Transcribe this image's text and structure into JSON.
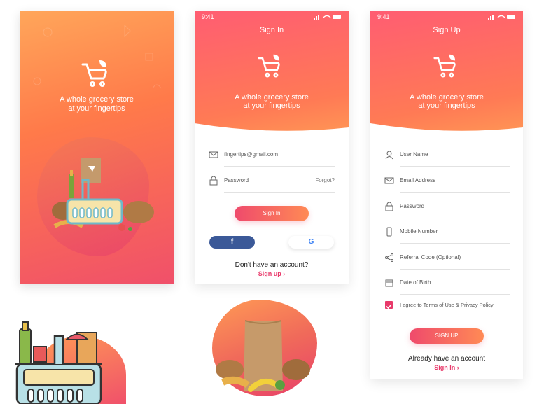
{
  "splash": {
    "tagline_line1": "A whole grocery store",
    "tagline_line2": "at your fingertips"
  },
  "signin": {
    "status_time": "9:41",
    "title": "Sign In",
    "tagline_line1": "A whole grocery store",
    "tagline_line2": "at your fingertips",
    "email_value": "fingertips@gmail.com",
    "password_placeholder": "Password",
    "forgot_label": "Forgot?",
    "signin_button": "Sign In",
    "facebook_glyph": "f",
    "google_glyph": "G",
    "no_account_text": "Don't have an account?",
    "signup_link": "Sign up"
  },
  "signup": {
    "status_time": "9:41",
    "title": "Sign Up",
    "tagline_line1": "A whole grocery store",
    "tagline_line2": "at your fingertips",
    "fields": {
      "username": "User Name",
      "email": "Email Address",
      "password": "Password",
      "mobile": "Mobile Number",
      "referral": "Referral Code (Optional)",
      "dob": "Date of Birth"
    },
    "agree_text": "I agree to Terms of Use & Privacy Policy",
    "agree_checked": true,
    "signup_button": "SIGN UP",
    "have_account_text": "Already have an account",
    "signin_link": "Sign In"
  },
  "colors": {
    "accent_pink": "#e8396a",
    "gradient_orange": "#ff9b55",
    "facebook_blue": "#3b5998"
  },
  "icons": [
    "cart-logo-icon",
    "mail-icon",
    "lock-icon",
    "user-icon",
    "phone-icon",
    "share-icon",
    "calendar-icon",
    "facebook-icon",
    "google-icon",
    "chevron-right-icon",
    "grocery-basket-illustration",
    "paper-bag-illustration"
  ]
}
